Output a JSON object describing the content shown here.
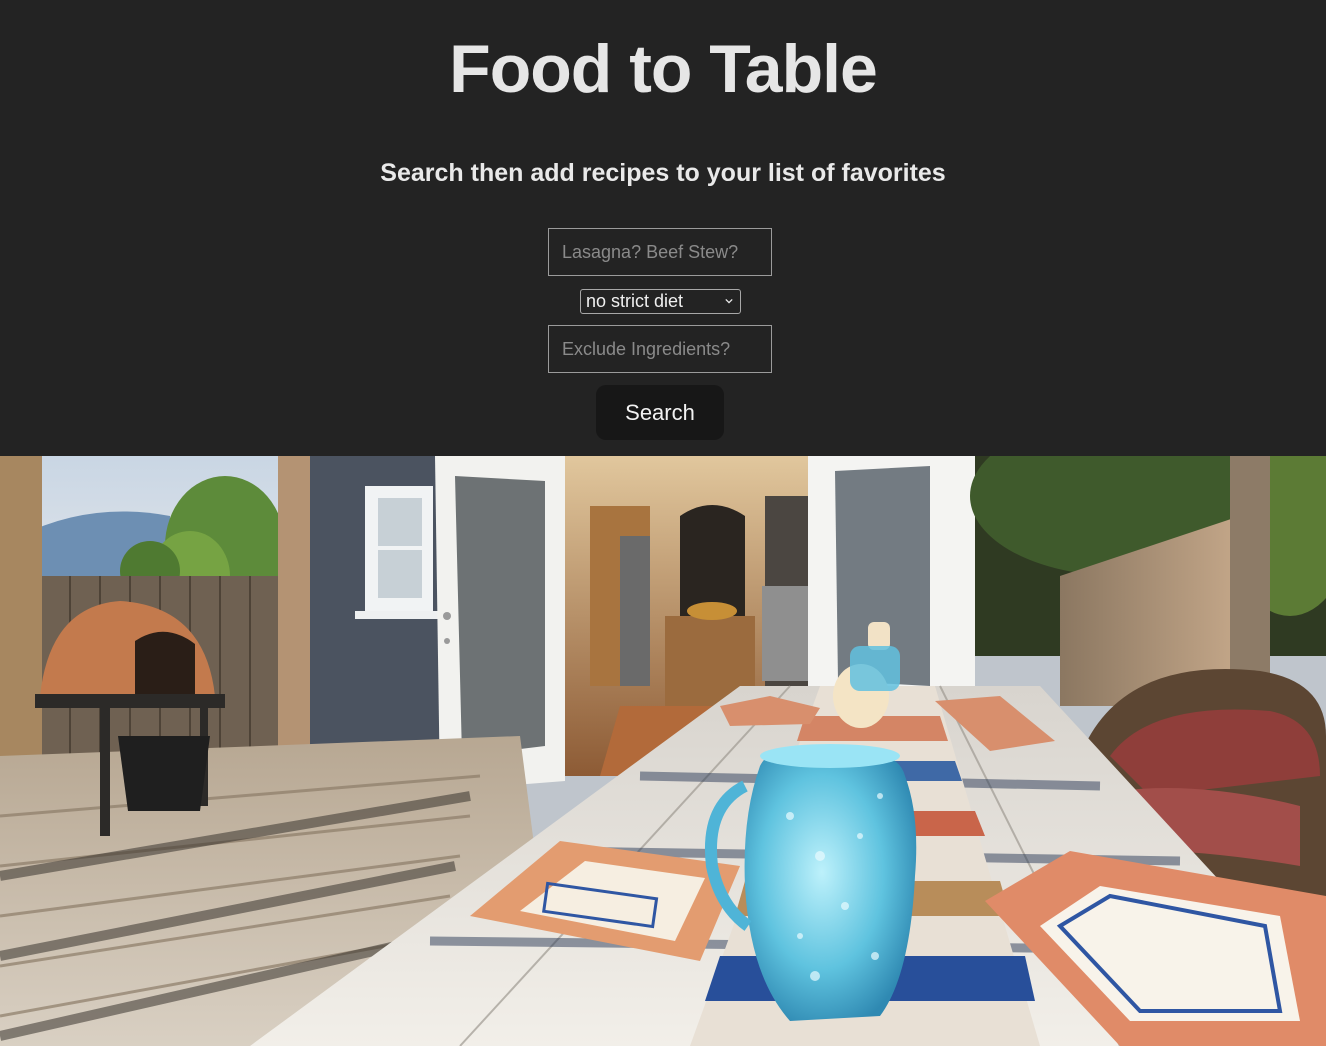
{
  "app": {
    "title": "Food to Table",
    "subtitle": "Search then add recipes to your list of favorites"
  },
  "search_form": {
    "recipe_placeholder": "Lasagna? Beef Stew?",
    "recipe_value": "",
    "diet_selected": "no strict diet",
    "exclude_placeholder": "Exclude Ingredients?",
    "exclude_value": "",
    "search_label": "Search"
  },
  "hero_image": {
    "alt": "Outdoor patio dining table with blue glass pitcher, candles and painted plates, open french doors to kitchen, pizza oven on wooden deck"
  },
  "colors": {
    "background": "#232323",
    "button": "#171717",
    "title_text": "#e6e6e6",
    "input_border": "#9b9b9b"
  }
}
